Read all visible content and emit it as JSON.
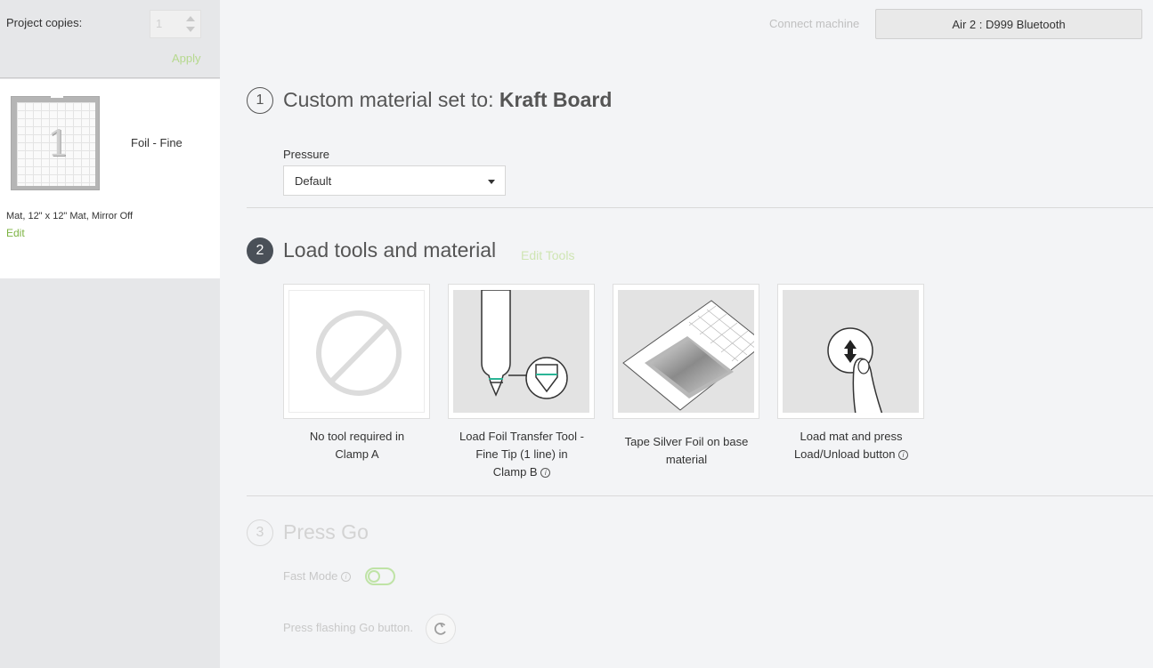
{
  "sidebar": {
    "copies_label": "Project copies:",
    "copies_value": "1",
    "apply_label": "Apply",
    "mat": {
      "number": "1",
      "title": "Foil - Fine",
      "info": "Mat, 12\" x 12\" Mat, Mirror Off",
      "edit_label": "Edit"
    }
  },
  "header": {
    "connect_label": "Connect machine",
    "machine_name": "Air 2 : D999 Bluetooth"
  },
  "step1": {
    "number": "1",
    "title_prefix": "Custom material set to: ",
    "material": "Kraft Board",
    "pressure_label": "Pressure",
    "pressure_value": "Default"
  },
  "step2": {
    "number": "2",
    "title": "Load tools and material",
    "edit_tools_label": "Edit Tools",
    "tools": [
      {
        "line1": "No tool required in",
        "line2": "Clamp A"
      },
      {
        "line1": "Load Foil Transfer Tool -",
        "line2": "Fine Tip (1 line) in",
        "line3": "Clamp B"
      },
      {
        "line1": "Tape Silver Foil on base",
        "line2": "material"
      },
      {
        "line1": "Load mat and press",
        "line2": "Load/Unload button"
      }
    ]
  },
  "step3": {
    "number": "3",
    "title": "Press Go",
    "fast_mode_label": "Fast Mode",
    "fast_mode_on": false,
    "go_label": "Press flashing Go button."
  },
  "colors": {
    "accent_green": "#7cb342",
    "step_dark": "#4a5058",
    "sidebar_bg": "#e6e7e9"
  }
}
